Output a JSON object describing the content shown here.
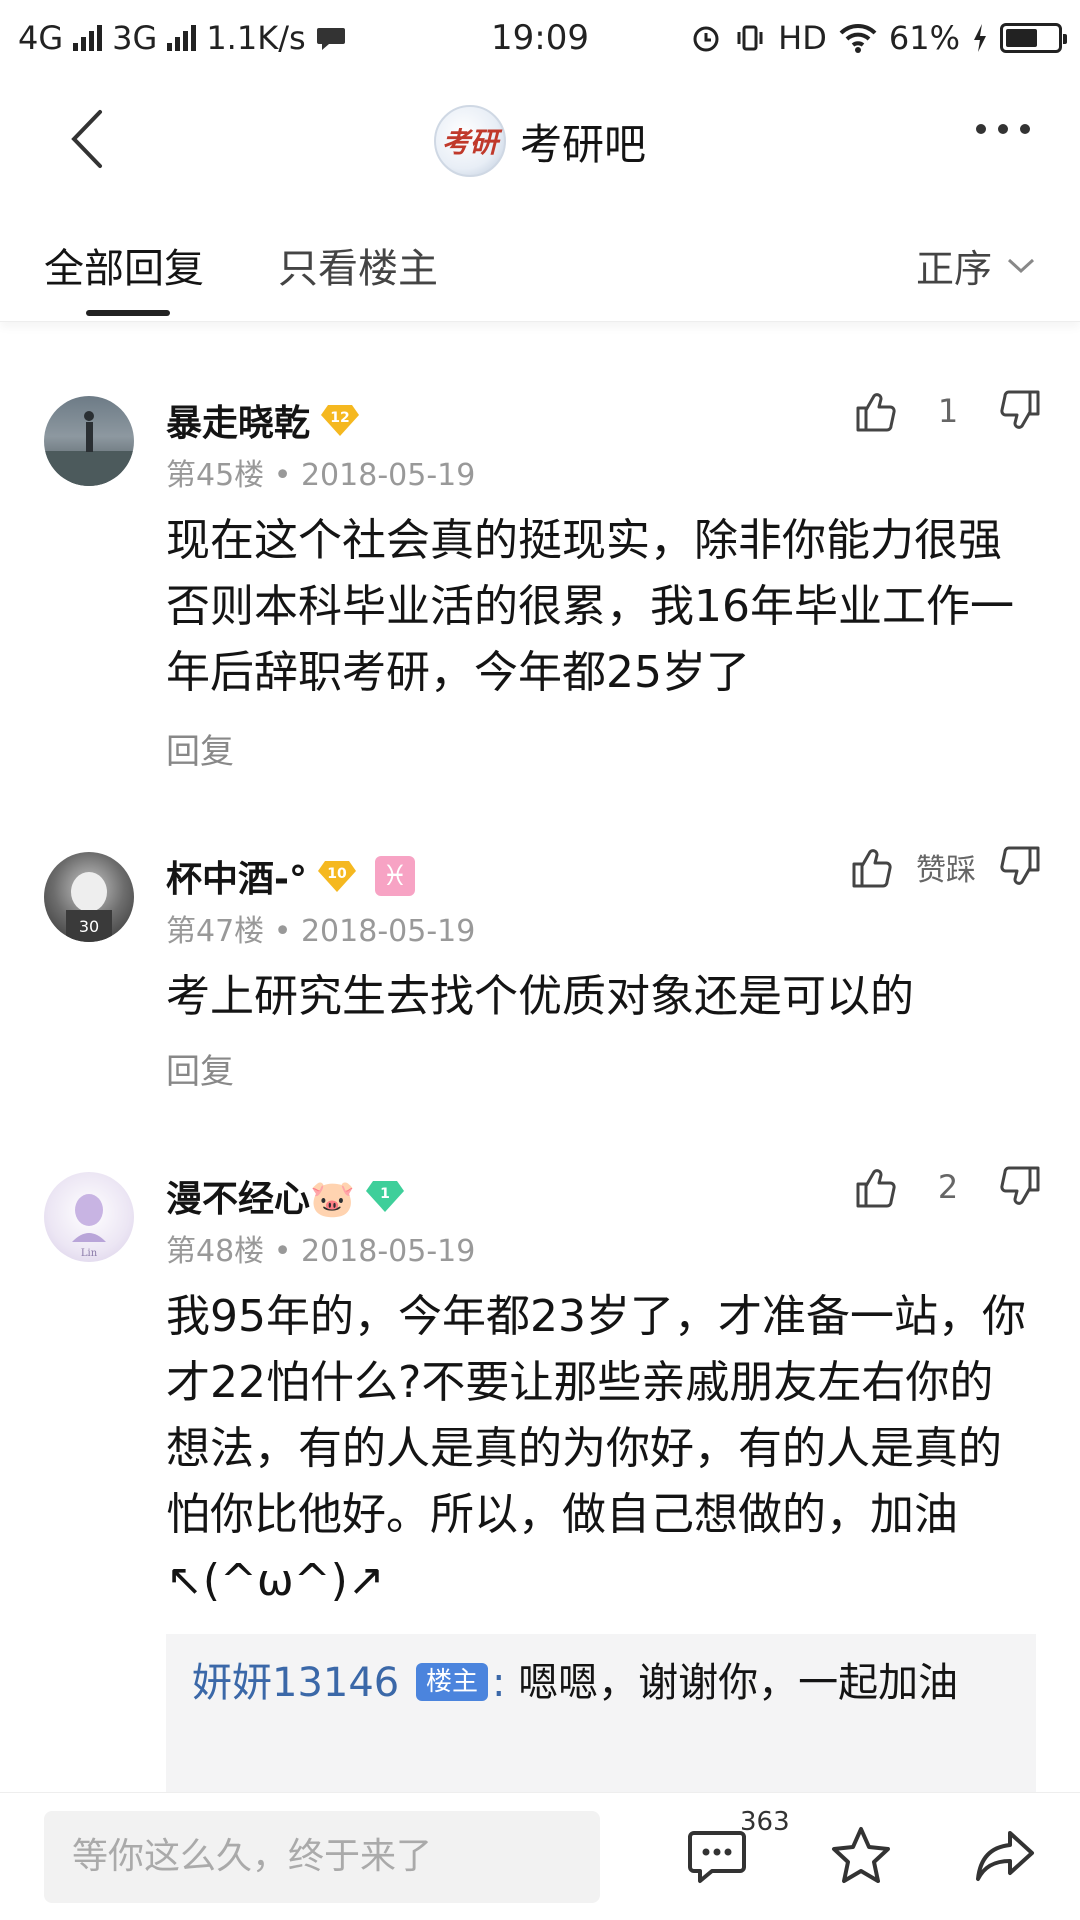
{
  "status": {
    "net1": "4G",
    "net2": "3G",
    "speed": "1.1K/s",
    "time": "19:09",
    "hd": "HD",
    "battery": "61%",
    "battery_level": 0.61
  },
  "nav": {
    "logo_text": "考研",
    "title": "考研吧"
  },
  "tabs": {
    "all": "全部回复",
    "op_only": "只看楼主",
    "sort": "正序"
  },
  "posts": [
    {
      "username": "暴走晓乾",
      "level": "12",
      "floor": "第45楼",
      "date": "2018-05-19",
      "content": "现在这个社会真的挺现实，除非你能力很强否则本科毕业活的很累，我16年毕业工作一年后辞职考研，今年都25岁了",
      "reply": "回复",
      "likes": "1",
      "like_color": "#f5b820"
    },
    {
      "username": "杯中酒-°",
      "level": "10",
      "zodiac": "♓",
      "floor": "第47楼",
      "date": "2018-05-19",
      "content": "考上研究生去找个优质对象还是可以的",
      "reply": "回复",
      "likes": "赞踩",
      "like_color": "#f5b820"
    },
    {
      "username": "漫不经心🐷",
      "level": "1",
      "floor": "第48楼",
      "date": "2018-05-19",
      "content": "我95年的，今年都23岁了，才准备一站，你才22怕什么?不要让那些亲戚朋友左右你的想法，有的人是真的为你好，有的人是真的怕你比他好。所以，做自己想做的，加油↖(^ω^)↗",
      "likes": "2",
      "like_color": "#3ecf9a",
      "subreply": {
        "who": "妍妍13146",
        "badge": "楼主",
        "sep": ":",
        "text": "嗯嗯，谢谢你，一起加油"
      }
    }
  ],
  "bottom": {
    "placeholder": "等你这么久，终于来了",
    "comment_count": "363"
  },
  "icons": [
    "back-icon",
    "more-icon",
    "chevron-down-icon",
    "thumb-up-icon",
    "thumb-down-icon",
    "comment-icon",
    "star-icon",
    "share-icon"
  ]
}
